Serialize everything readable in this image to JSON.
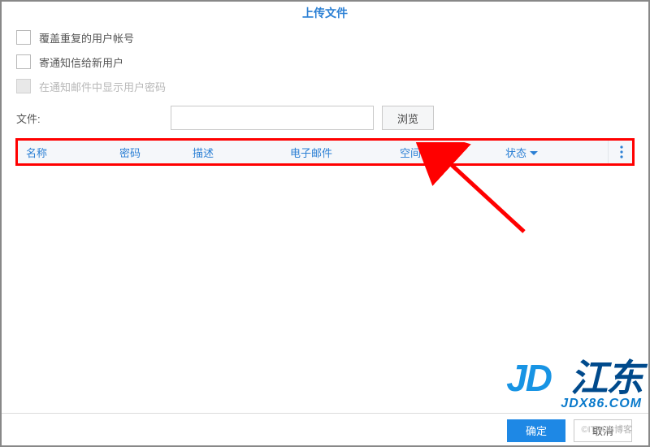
{
  "dialog": {
    "title": "上传文件"
  },
  "options": {
    "overwrite": {
      "label": "覆盖重复的用户帐号",
      "checked": false,
      "enabled": true
    },
    "notify": {
      "label": "寄通知信给新用户",
      "checked": false,
      "enabled": true
    },
    "showpwd": {
      "label": "在通知邮件中显示用户密码",
      "checked": false,
      "enabled": false
    }
  },
  "file": {
    "label": "文件:",
    "value": "",
    "browse": "浏览"
  },
  "table": {
    "columns": {
      "name": "名称",
      "password": "密码",
      "desc": "描述",
      "email": "电子邮件",
      "quota": "空间配额",
      "status": "状态"
    },
    "rows": []
  },
  "footer": {
    "ok": "确定",
    "cancel": "取消"
  },
  "branding": {
    "logo_text_1": "JD",
    "logo_text_2": "江东",
    "logo_sub": "JDX86.COM"
  },
  "watermark": "©ITPUB博客"
}
